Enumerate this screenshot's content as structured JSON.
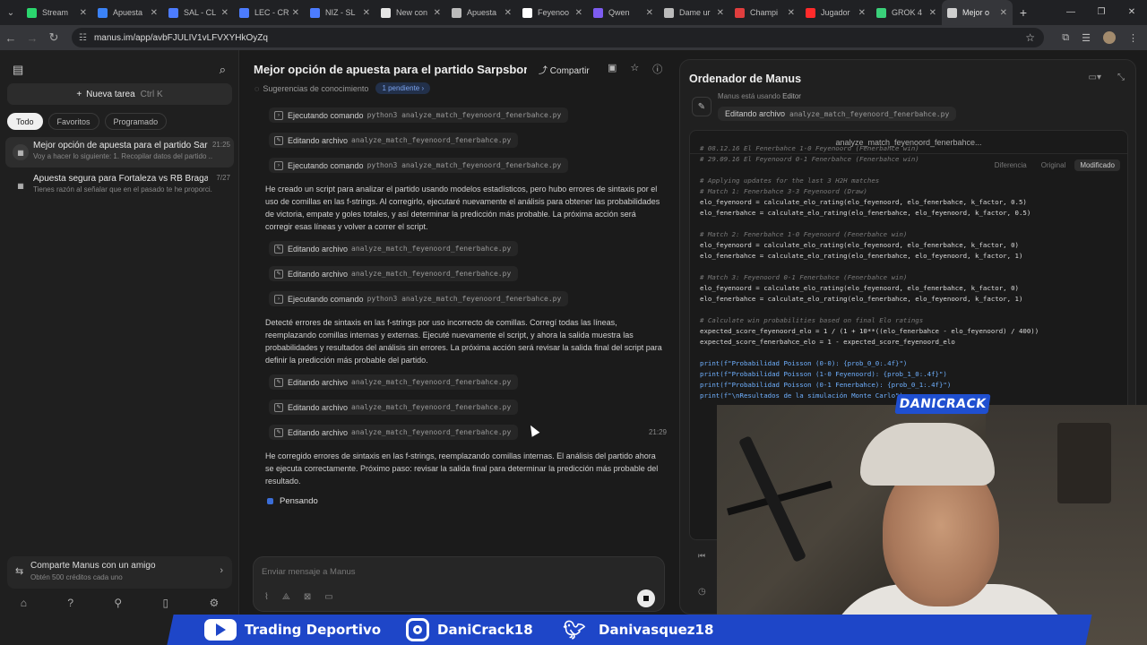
{
  "browser": {
    "tabs": [
      {
        "label": "Stream",
        "color": "#2bd66e"
      },
      {
        "label": "Apuesta",
        "color": "#3b82f6"
      },
      {
        "label": "SAL - CL",
        "color": "#4c7cff"
      },
      {
        "label": "LEC - CR",
        "color": "#4c7cff"
      },
      {
        "label": "NIZ - SL",
        "color": "#4c7cff"
      },
      {
        "label": "New con",
        "color": "#e5e5e5"
      },
      {
        "label": "Apuesta",
        "color": "#bbbbbb"
      },
      {
        "label": "Feyenoo",
        "color": "#ffffff"
      },
      {
        "label": "Qwen",
        "color": "#7d5cf0"
      },
      {
        "label": "Dame ur",
        "color": "#bbbbbb"
      },
      {
        "label": "Champi",
        "color": "#e03e3e"
      },
      {
        "label": "Jugador",
        "color": "#ff2b2b"
      },
      {
        "label": "GROK 4",
        "color": "#3ad07a"
      },
      {
        "label": "Mejor o",
        "color": "#cfcfcf"
      }
    ],
    "url": "manus.im/app/avbFJULIV1vLFVXYHkOyZq"
  },
  "sidebar": {
    "new_task": "Nueva tarea",
    "new_task_kbd": "Ctrl  K",
    "filters": [
      "Todo",
      "Favoritos",
      "Programado"
    ],
    "tasks": [
      {
        "title": "Mejor opción de apuesta para el partido Sarp...",
        "subtitle": "Voy a hacer lo siguiente: 1. Recopilar datos del partido ...",
        "time": "21:25"
      },
      {
        "title": "Apuesta segura para Fortaleza vs RB Bragantino",
        "subtitle": "Tienes razón al señalar que en el pasado te he proporci...",
        "time": "7/27"
      }
    ],
    "share_title": "Comparte Manus con un amigo",
    "share_sub": "Obtén 500 créditos cada uno"
  },
  "main": {
    "title": "Mejor opción de apuesta para el partido Sarpsborg v...",
    "share": "Compartir",
    "suggest": "Sugerencias de conocimiento",
    "pending": "1 pendiente",
    "steps": [
      {
        "label": "Ejecutando comando",
        "mono": "python3 analyze_match_feyenoord_fenerbahce.py"
      },
      {
        "label": "Editando archivo",
        "mono": "analyze_match_feyenoord_fenerbahce.py"
      },
      {
        "label": "Ejecutando comando",
        "mono": "python3 analyze_match_feyenoord_fenerbahce.py"
      },
      {
        "label": "Editando archivo",
        "mono": "analyze_match_feyenoord_fenerbahce.py"
      },
      {
        "label": "Editando archivo",
        "mono": "analyze_match_feyenoord_fenerbahce.py"
      },
      {
        "label": "Ejecutando comando",
        "mono": "python3 analyze_match_feyenoord_fenerbahce.py"
      },
      {
        "label": "Editando archivo",
        "mono": "analyze_match_feyenoord_fenerbahce.py"
      },
      {
        "label": "Editando archivo",
        "mono": "analyze_match_feyenoord_fenerbahce.py"
      },
      {
        "label": "Editando archivo",
        "mono": "analyze_match_feyenoord_fenerbahce.py"
      }
    ],
    "step_time": "21:29",
    "paragraphs": [
      "He creado un script para analizar el partido usando modelos estadísticos, pero hubo errores de sintaxis por el uso de comillas en las f-strings. Al corregirlo, ejecutaré nuevamente el análisis para obtener las probabilidades de victoria, empate y goles totales, y así determinar la predicción más probable. La próxima acción será corregir esas líneas y volver a correr el script.",
      "Detecté errores de sintaxis en las f-strings por uso incorrecto de comillas. Corregí todas las líneas, reemplazando comillas internas y externas. Ejecuté nuevamente el script, y ahora la salida muestra las probabilidades y resultados del análisis sin errores. La próxima acción será revisar la salida final del script para definir la predicción más probable del partido.",
      "He corregido errores de sintaxis en las f-strings, reemplazando comillas internas. El análisis del partido ahora se ejecuta correctamente. Próximo paso: revisar la salida final para determinar la predicción más probable del resultado."
    ],
    "thinking": "Pensando",
    "composer_placeholder": "Enviar mensaje a Manus"
  },
  "computer": {
    "title": "Ordenador de Manus",
    "using": "Manus está usando",
    "using_app": "Editor",
    "action": "Editando archivo",
    "action_file": "analyze_match_feyenoord_fenerbahce.py",
    "file_header": "analyze_match_feyenoord_fenerbahce...",
    "view_tabs": [
      "Diferencia",
      "Original",
      "Modificado"
    ],
    "code_lines": [
      {
        "t": "c",
        "s": "# 08.12.16 El Fenerbahce 1-0 Feyenoord (Fenerbahce win)"
      },
      {
        "t": "c",
        "s": "# 29.09.16 El Feyenoord 0-1 Fenerbahce (Fenerbahce win)"
      },
      {
        "t": "n",
        "s": ""
      },
      {
        "t": "c",
        "s": "# Applying updates for the last 3 H2H matches"
      },
      {
        "t": "c",
        "s": "# Match 1: Fenerbahce 3-3 Feyenoord (Draw)"
      },
      {
        "t": "f",
        "s": "elo_feyenoord = calculate_elo_rating(elo_feyenoord, elo_fenerbahce, k_factor, 0.5)"
      },
      {
        "t": "f",
        "s": "elo_fenerbahce = calculate_elo_rating(elo_fenerbahce, elo_feyenoord, k_factor, 0.5)"
      },
      {
        "t": "n",
        "s": ""
      },
      {
        "t": "c",
        "s": "# Match 2: Fenerbahce 1-0 Feyenoord (Fenerbahce win)"
      },
      {
        "t": "f",
        "s": "elo_feyenoord = calculate_elo_rating(elo_feyenoord, elo_fenerbahce, k_factor, 0)"
      },
      {
        "t": "f",
        "s": "elo_fenerbahce = calculate_elo_rating(elo_fenerbahce, elo_feyenoord, k_factor, 1)"
      },
      {
        "t": "n",
        "s": ""
      },
      {
        "t": "c",
        "s": "# Match 3: Feyenoord 0-1 Fenerbahce (Fenerbahce win)"
      },
      {
        "t": "f",
        "s": "elo_feyenoord = calculate_elo_rating(elo_feyenoord, elo_fenerbahce, k_factor, 0)"
      },
      {
        "t": "f",
        "s": "elo_fenerbahce = calculate_elo_rating(elo_fenerbahce, elo_feyenoord, k_factor, 1)"
      },
      {
        "t": "n",
        "s": ""
      },
      {
        "t": "c",
        "s": "# Calculate win probabilities based on final Elo ratings"
      },
      {
        "t": "n",
        "s": "expected_score_feyenoord_elo = 1 / (1 + 10**((elo_fenerbahce - elo_feyenoord) / 400))"
      },
      {
        "t": "n",
        "s": "expected_score_fenerbahce_elo = 1 - expected_score_feyenoord_elo"
      },
      {
        "t": "n",
        "s": ""
      },
      {
        "t": "p",
        "s": "print(f\"Probabilidad Poisson (0-0): {prob_0_0:.4f}\")"
      },
      {
        "t": "p",
        "s": "print(f\"Probabilidad Poisson (1-0 Feyenoord): {prob_1_0:.4f}\")"
      },
      {
        "t": "p",
        "s": "print(f\"Probabilidad Poisson (0-1 Fenerbahce): {prob_0_1:.4f}\")"
      },
      {
        "t": "p",
        "s": "print(f\"\\nResultados de la simulación Monte Carlo\")"
      }
    ]
  },
  "overlay": {
    "streamer_tag": "DANICRACK",
    "socials": [
      {
        "icon": "youtube-icon",
        "label": "Trading Deportivo"
      },
      {
        "icon": "instagram-icon",
        "label": "DaniCrack18"
      },
      {
        "icon": "twitter-icon",
        "label": "Danivasquez18"
      }
    ]
  }
}
